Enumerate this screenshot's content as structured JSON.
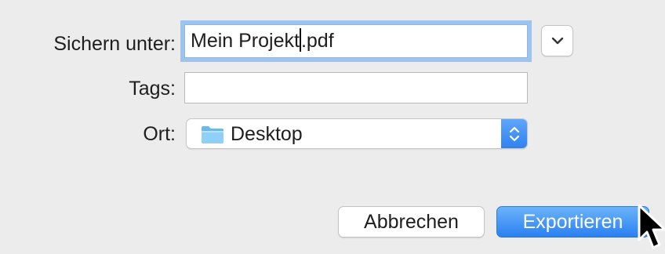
{
  "dialog": {
    "save_as_label": "Sichern unter:",
    "filename_before_caret": "Mein Projekt",
    "filename_after_caret": ".pdf",
    "tags_label": "Tags:",
    "tags_value": "",
    "where_label": "Ort:",
    "location": "Desktop",
    "location_icon": "folder-icon",
    "expand_icon": "chevron-down-icon",
    "stepper_icon": "up-down-arrows-icon"
  },
  "buttons": {
    "cancel": "Abbrechen",
    "export": "Exportieren"
  },
  "colors": {
    "accent": "#2f82f2",
    "focus_ring": "#9cc4ee",
    "background": "#ececec",
    "folder": "#7cc6f5"
  }
}
